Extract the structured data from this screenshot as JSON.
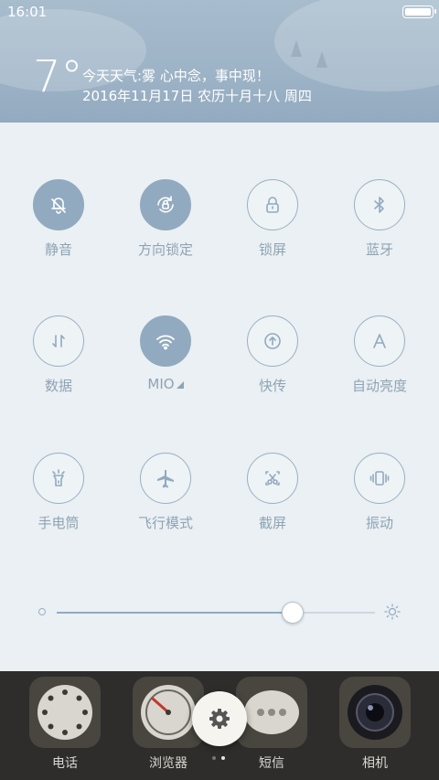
{
  "status": {
    "time": "16:01"
  },
  "weather": {
    "temp": "7°",
    "line1": "今天天气:雾  心中念，事中现！",
    "line2": "2016年11月17日 农历十月十八 周四"
  },
  "toggles": [
    {
      "label": "静音",
      "icon": "bell-off-icon",
      "on": true
    },
    {
      "label": "方向锁定",
      "icon": "rotation-lock-icon",
      "on": true
    },
    {
      "label": "锁屏",
      "icon": "lock-icon",
      "on": false
    },
    {
      "label": "蓝牙",
      "icon": "bluetooth-icon",
      "on": false
    },
    {
      "label": "数据",
      "icon": "mobile-data-icon",
      "on": false
    },
    {
      "label": "MIO",
      "icon": "wifi-icon",
      "on": true
    },
    {
      "label": "快传",
      "icon": "quick-transfer-icon",
      "on": false
    },
    {
      "label": "自动亮度",
      "icon": "auto-brightness-icon",
      "on": false
    },
    {
      "label": "手电筒",
      "icon": "flashlight-icon",
      "on": false
    },
    {
      "label": "飞行模式",
      "icon": "airplane-icon",
      "on": false
    },
    {
      "label": "截屏",
      "icon": "screenshot-icon",
      "on": false
    },
    {
      "label": "振动",
      "icon": "vibrate-icon",
      "on": false
    }
  ],
  "brightness": {
    "level": 0.74
  },
  "dock": [
    {
      "label": "电话",
      "icon": "phone-app-icon"
    },
    {
      "label": "浏览器",
      "icon": "browser-app-icon"
    },
    {
      "label": "短信",
      "icon": "messages-app-icon"
    },
    {
      "label": "相机",
      "icon": "camera-app-icon"
    }
  ],
  "colors": {
    "accent": "#91aac0",
    "panel": "#eaf0f3",
    "label": "#8fa3b5"
  }
}
